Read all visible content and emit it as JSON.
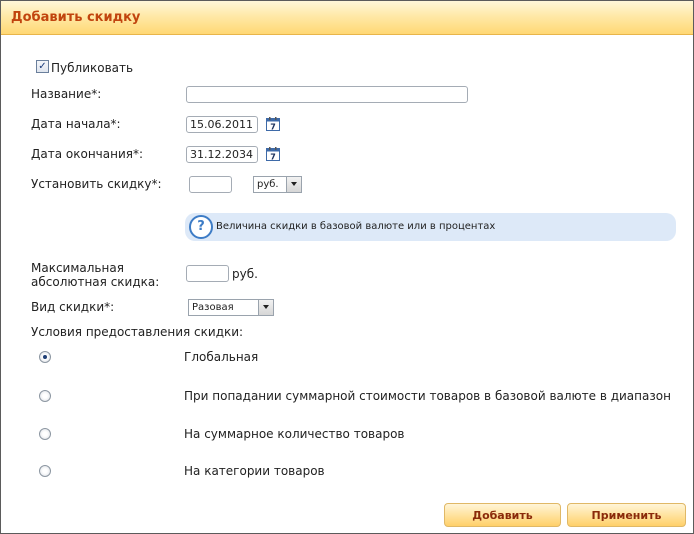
{
  "dialog": {
    "title": "Добавить скидку"
  },
  "form": {
    "publish_label": "Публиковать",
    "publish_checked": true,
    "name_label": "Название*:",
    "name_value": "",
    "start_label": "Дата начала*:",
    "start_value": "15.06.2011",
    "end_label": "Дата окончания*:",
    "end_value": "31.12.2034",
    "discount_label": "Установить скидку*:",
    "discount_value": "",
    "currency_selected": "руб.",
    "hint": "Величина скидки в базовой валюте или в процентах",
    "max_label_line1": "Максимальная",
    "max_label_line2": "абсолютная скидка:",
    "max_value": "",
    "max_unit": "руб.",
    "type_label": "Вид скидки*:",
    "type_selected": "Разовая",
    "conditions_label": "Условия предоставления скидки:"
  },
  "conditions": [
    {
      "label": "Глобальная",
      "checked": true
    },
    {
      "label": "При попадании суммарной стоимости товаров в базовой валюте в диапазон",
      "checked": false
    },
    {
      "label": "На суммарное количество товаров",
      "checked": false
    },
    {
      "label": "На категории товаров",
      "checked": false
    }
  ],
  "buttons": {
    "add": "Добавить",
    "apply": "Применить"
  },
  "icons": {
    "calendar": "calendar-icon",
    "help": "question-icon",
    "checkbox": "checkmark-icon"
  },
  "colors": {
    "title_text": "#c1440e",
    "title_bg": "#ffe9a8",
    "hint_bg": "#dde9f8",
    "button_bg": "#ffe19a",
    "button_text": "#8a2a0a"
  }
}
